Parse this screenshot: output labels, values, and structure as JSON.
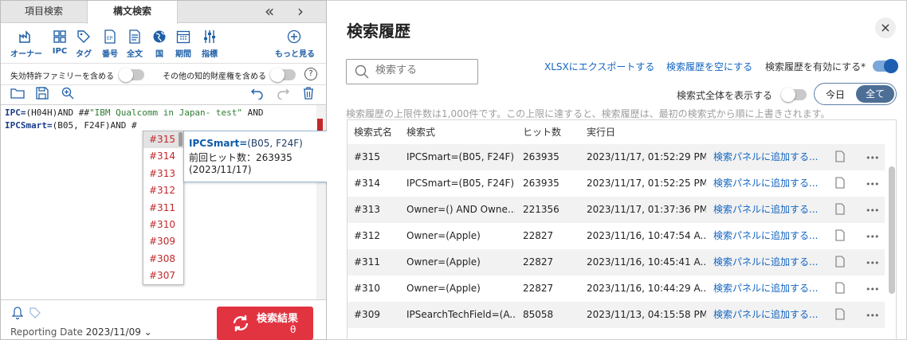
{
  "tabs": {
    "item_search": "項目検索",
    "syntax_search": "構文検索",
    "back": "«",
    "forward": "›"
  },
  "toolbar": [
    {
      "label": "オーナー",
      "icon": "owner-icon"
    },
    {
      "label": "IPC",
      "icon": "ipc-grid-icon"
    },
    {
      "label": "タグ",
      "icon": "tag-icon"
    },
    {
      "label": "番号",
      "icon": "number-doc-icon"
    },
    {
      "label": "全文",
      "icon": "fulltext-icon"
    },
    {
      "label": "国",
      "icon": "globe-icon"
    },
    {
      "label": "期間",
      "icon": "calendar-icon"
    },
    {
      "label": "指標",
      "icon": "sliders-icon"
    },
    {
      "label": "もっと見る",
      "icon": "plus-circle-icon"
    }
  ],
  "options": {
    "expired_family": "失効特許ファミリーを含める",
    "other_ip": "その他の知的財産権を含める",
    "help": "?"
  },
  "editor": {
    "line1": {
      "kw1": "IPC=",
      "rest1": "(H04H)AND ##",
      "str": "\"IBM Qualcomm in Japan- test\"",
      "rest2": " AND"
    },
    "line2": {
      "kw1": "IPCSmart=",
      "rest1": "(B05, F24F)AND #"
    }
  },
  "autocomplete": {
    "items": [
      "#315",
      "#314",
      "#313",
      "#312",
      "#311",
      "#310",
      "#309",
      "#308",
      "#307"
    ],
    "tip_name": "IPCSmart=",
    "tip_args": "(B05, F24F)",
    "tip_hits": "前回ヒット数：263935 (2023/11/17)"
  },
  "bottom": {
    "reporting_label": "Reporting Date",
    "reporting_date": "2023/11/09",
    "search_button": "検索結果",
    "theta": "θ"
  },
  "history": {
    "title": "検索履歴",
    "close": "×",
    "search_placeholder": "検索する",
    "export_xlsx": "XLSXにエクスポートする",
    "clear_history": "検索履歴を空にする",
    "enable_history": "検索履歴を有効にする*",
    "show_full": "検索式全体を表示する",
    "today": "今日",
    "all": "全て",
    "limit_note": "検索履歴の上限件数は1,000件です。この上限に達すると、検索履歴は、最初の検索式から順に上書きされます。",
    "columns": [
      "検索式名",
      "検索式",
      "ヒット数",
      "実行日"
    ],
    "rows": [
      {
        "name": "#315",
        "query": "IPCSmart=(B05, F24F)",
        "hits": "263935",
        "date": "2023/11/17, 01:52:29 PM",
        "action": "検索パネルに追加する..."
      },
      {
        "name": "#314",
        "query": "IPCSmart=(B05, F24F)",
        "hits": "263935",
        "date": "2023/11/17, 01:52:25 PM",
        "action": "検索パネルに追加する..."
      },
      {
        "name": "#313",
        "query": "Owner=() AND Owne...",
        "hits": "221356",
        "date": "2023/11/17, 01:37:36 PM",
        "action": "検索パネルに追加する..."
      },
      {
        "name": "#312",
        "query": "Owner=(Apple)",
        "hits": "22827",
        "date": "2023/11/16, 10:47:54 A...",
        "action": "検索パネルに追加する..."
      },
      {
        "name": "#311",
        "query": "Owner=(Apple)",
        "hits": "22827",
        "date": "2023/11/16, 10:45:41 A...",
        "action": "検索パネルに追加する..."
      },
      {
        "name": "#310",
        "query": "Owner=(Apple)",
        "hits": "22827",
        "date": "2023/11/16, 10:44:29 A...",
        "action": "検索パネルに追加する..."
      },
      {
        "name": "#309",
        "query": "IPSearchTechField=(A...",
        "hits": "85058",
        "date": "2023/11/13, 04:15:58 PM",
        "action": "検索パネルに追加する..."
      }
    ]
  },
  "colors": {
    "accent": "#1565c0",
    "danger": "#e23341",
    "toggle_on": "#1d5fb0"
  }
}
